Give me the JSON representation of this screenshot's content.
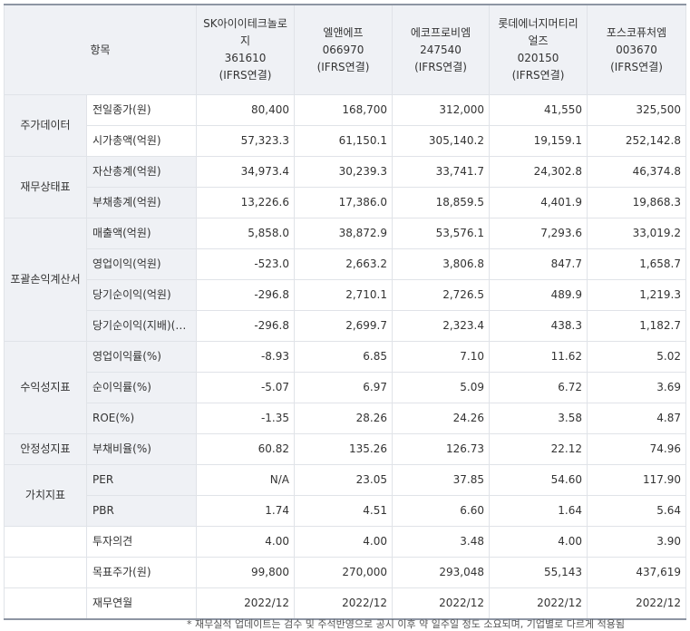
{
  "header": {
    "item": "항목",
    "companies": [
      {
        "name": "SK아이이테크놀로지",
        "code": "361610",
        "basis": "(IFRS연결)"
      },
      {
        "name": "엘앤에프",
        "code": "066970",
        "basis": "(IFRS연결)"
      },
      {
        "name": "에코프로비엠",
        "code": "247540",
        "basis": "(IFRS연결)"
      },
      {
        "name": "롯데에너지머티리얼즈",
        "code": "020150",
        "basis": "(IFRS연결)"
      },
      {
        "name": "포스코퓨처엠",
        "code": "003670",
        "basis": "(IFRS연결)"
      }
    ]
  },
  "groups": {
    "stock": "주가데이터",
    "balance": "재무상태표",
    "income": "포괄손익계산서",
    "profit": "수익성지표",
    "stability": "안정성지표",
    "value": "가치지표"
  },
  "rows": [
    {
      "label": "전일종가(원)",
      "values": [
        "80,400",
        "168,700",
        "312,000",
        "41,550",
        "325,500"
      ]
    },
    {
      "label": "시가총액(억원)",
      "values": [
        "57,323.3",
        "61,150.1",
        "305,140.2",
        "19,159.1",
        "252,142.8"
      ]
    },
    {
      "label": "자산총계(억원)",
      "values": [
        "34,973.4",
        "30,239.3",
        "33,741.7",
        "24,302.8",
        "46,374.8"
      ]
    },
    {
      "label": "부채총계(억원)",
      "values": [
        "13,226.6",
        "17,386.0",
        "18,859.5",
        "4,401.9",
        "19,868.3"
      ]
    },
    {
      "label": "매출액(억원)",
      "values": [
        "5,858.0",
        "38,872.9",
        "53,576.1",
        "7,293.6",
        "33,019.2"
      ]
    },
    {
      "label": "영업이익(억원)",
      "values": [
        "-523.0",
        "2,663.2",
        "3,806.8",
        "847.7",
        "1,658.7"
      ]
    },
    {
      "label": "당기순이익(억원)",
      "values": [
        "-296.8",
        "2,710.1",
        "2,726.5",
        "489.9",
        "1,219.3"
      ]
    },
    {
      "label": "당기순이익(지배)(…",
      "values": [
        "-296.8",
        "2,699.7",
        "2,323.4",
        "438.3",
        "1,182.7"
      ]
    },
    {
      "label": "영업이익률(%)",
      "values": [
        "-8.93",
        "6.85",
        "7.10",
        "11.62",
        "5.02"
      ]
    },
    {
      "label": "순이익률(%)",
      "values": [
        "-5.07",
        "6.97",
        "5.09",
        "6.72",
        "3.69"
      ]
    },
    {
      "label": "ROE(%)",
      "values": [
        "-1.35",
        "28.26",
        "24.26",
        "3.58",
        "4.87"
      ]
    },
    {
      "label": "부채비율(%)",
      "values": [
        "60.82",
        "135.26",
        "126.73",
        "22.12",
        "74.96"
      ]
    },
    {
      "label": "PER",
      "values": [
        "N/A",
        "23.05",
        "37.85",
        "54.60",
        "117.90"
      ]
    },
    {
      "label": "PBR",
      "values": [
        "1.74",
        "4.51",
        "6.60",
        "1.64",
        "5.64"
      ]
    },
    {
      "label": "투자의견",
      "values": [
        "4.00",
        "4.00",
        "3.48",
        "4.00",
        "3.90"
      ]
    },
    {
      "label": "목표주가(원)",
      "values": [
        "99,800",
        "270,000",
        "293,048",
        "55,143",
        "437,619"
      ]
    },
    {
      "label": "재무연월",
      "values": [
        "2022/12",
        "2022/12",
        "2022/12",
        "2022/12",
        "2022/12"
      ]
    }
  ],
  "footnote": "* 재무실적 업데이트는 검수 및 주석반영으로 공시 이후 약 일주일 정도 소요되며, 기업별로 다르게 적용됨"
}
